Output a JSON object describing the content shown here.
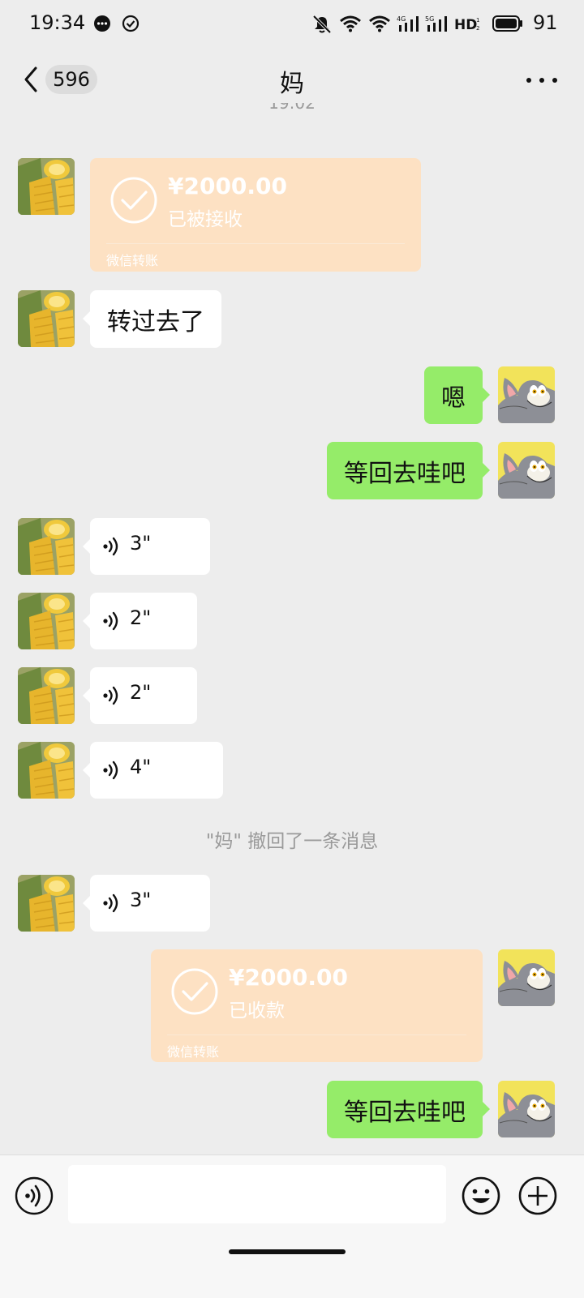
{
  "status_bar": {
    "time": "19:34",
    "battery": "91",
    "icons": [
      "message-notification-icon",
      "check-circle-icon",
      "mute-icon",
      "wifi-icon",
      "wifi-calling-icon",
      "signal-4g-icon",
      "signal-5g-icon",
      "hd-icon",
      "battery-icon"
    ]
  },
  "header": {
    "unread_count": "596",
    "title": "妈",
    "top_timestamp": "19:02"
  },
  "messages": {
    "transfer_received_amount": "¥2000.00",
    "transfer_received_status": "已被接收",
    "transfer_label": "微信转账",
    "text_1": "转过去了",
    "text_2": "嗯",
    "text_3": "等回去哇吧",
    "voice_1": "3\"",
    "voice_2": "2\"",
    "voice_3": "2\"",
    "voice_4": "4\"",
    "recall_notice": "\"妈\" 撤回了一条消息",
    "voice_5": "3\"",
    "transfer_sent_amount": "¥2000.00",
    "transfer_sent_status": "已收款",
    "transfer_label_2": "微信转账",
    "text_4": "等回去哇吧"
  },
  "colors": {
    "background": "#ededed",
    "green_bubble": "#95ec69",
    "white_bubble": "#ffffff",
    "transfer_bubble": "#fde1c3",
    "meta_text": "#9a9a9a"
  },
  "input": {
    "placeholder": ""
  }
}
